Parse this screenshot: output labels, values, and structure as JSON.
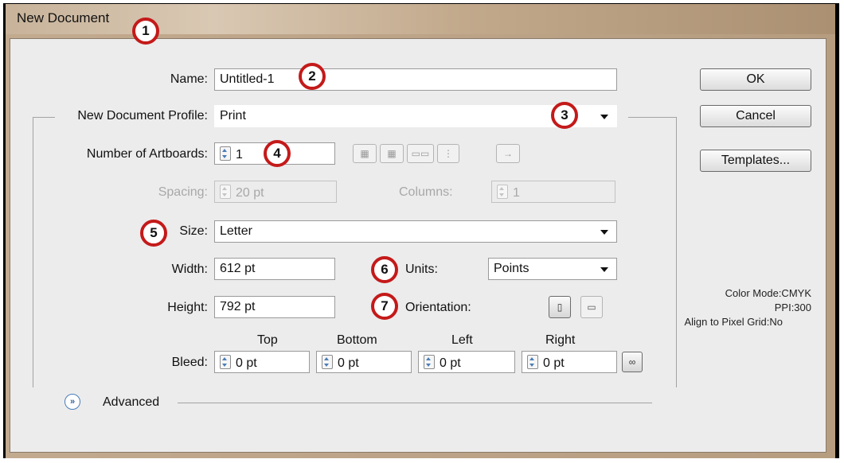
{
  "window": {
    "title": "New Document"
  },
  "markers": [
    "1",
    "2",
    "3",
    "4",
    "5",
    "6",
    "7"
  ],
  "name": {
    "label": "Name:",
    "value": "Untitled-1"
  },
  "profile": {
    "label": "New Document Profile:",
    "value": "Print"
  },
  "artboards": {
    "label": "Number of Artboards:",
    "value": "1"
  },
  "artboard_tools": {
    "arrange_icons": [
      "grid-by-row-icon",
      "grid-by-column-icon",
      "arrange-by-row-icon",
      "arrange-by-column-icon"
    ],
    "direction_icon": "right-to-left-layout-icon",
    "direction_glyph": "→"
  },
  "spacing": {
    "label": "Spacing:",
    "value": "20 pt"
  },
  "columns": {
    "label": "Columns:",
    "value": "1"
  },
  "size": {
    "label": "Size:",
    "value": "Letter"
  },
  "width": {
    "label": "Width:",
    "value": "612 pt"
  },
  "units": {
    "label": "Units:",
    "value": "Points"
  },
  "height": {
    "label": "Height:",
    "value": "792 pt"
  },
  "orientation": {
    "label": "Orientation:"
  },
  "bleed": {
    "label": "Bleed:",
    "top": {
      "label": "Top",
      "value": "0 pt"
    },
    "bottom": {
      "label": "Bottom",
      "value": "0 pt"
    },
    "left": {
      "label": "Left",
      "value": "0 pt"
    },
    "right": {
      "label": "Right",
      "value": "0 pt"
    }
  },
  "advanced": {
    "label": "Advanced",
    "icon": "expand-chevron-icon"
  },
  "buttons": {
    "ok": "OK",
    "cancel": "Cancel",
    "templates": "Templates..."
  },
  "info": {
    "color_mode": "Color Mode:CMYK",
    "ppi": "PPI:300",
    "align": "Align to Pixel Grid:No"
  },
  "colors": {
    "marker_ring": "#c41a1a",
    "spin_arrow": "#4a7db8",
    "dialog_bg": "#ececec",
    "title_bar": "#c8b39a"
  }
}
